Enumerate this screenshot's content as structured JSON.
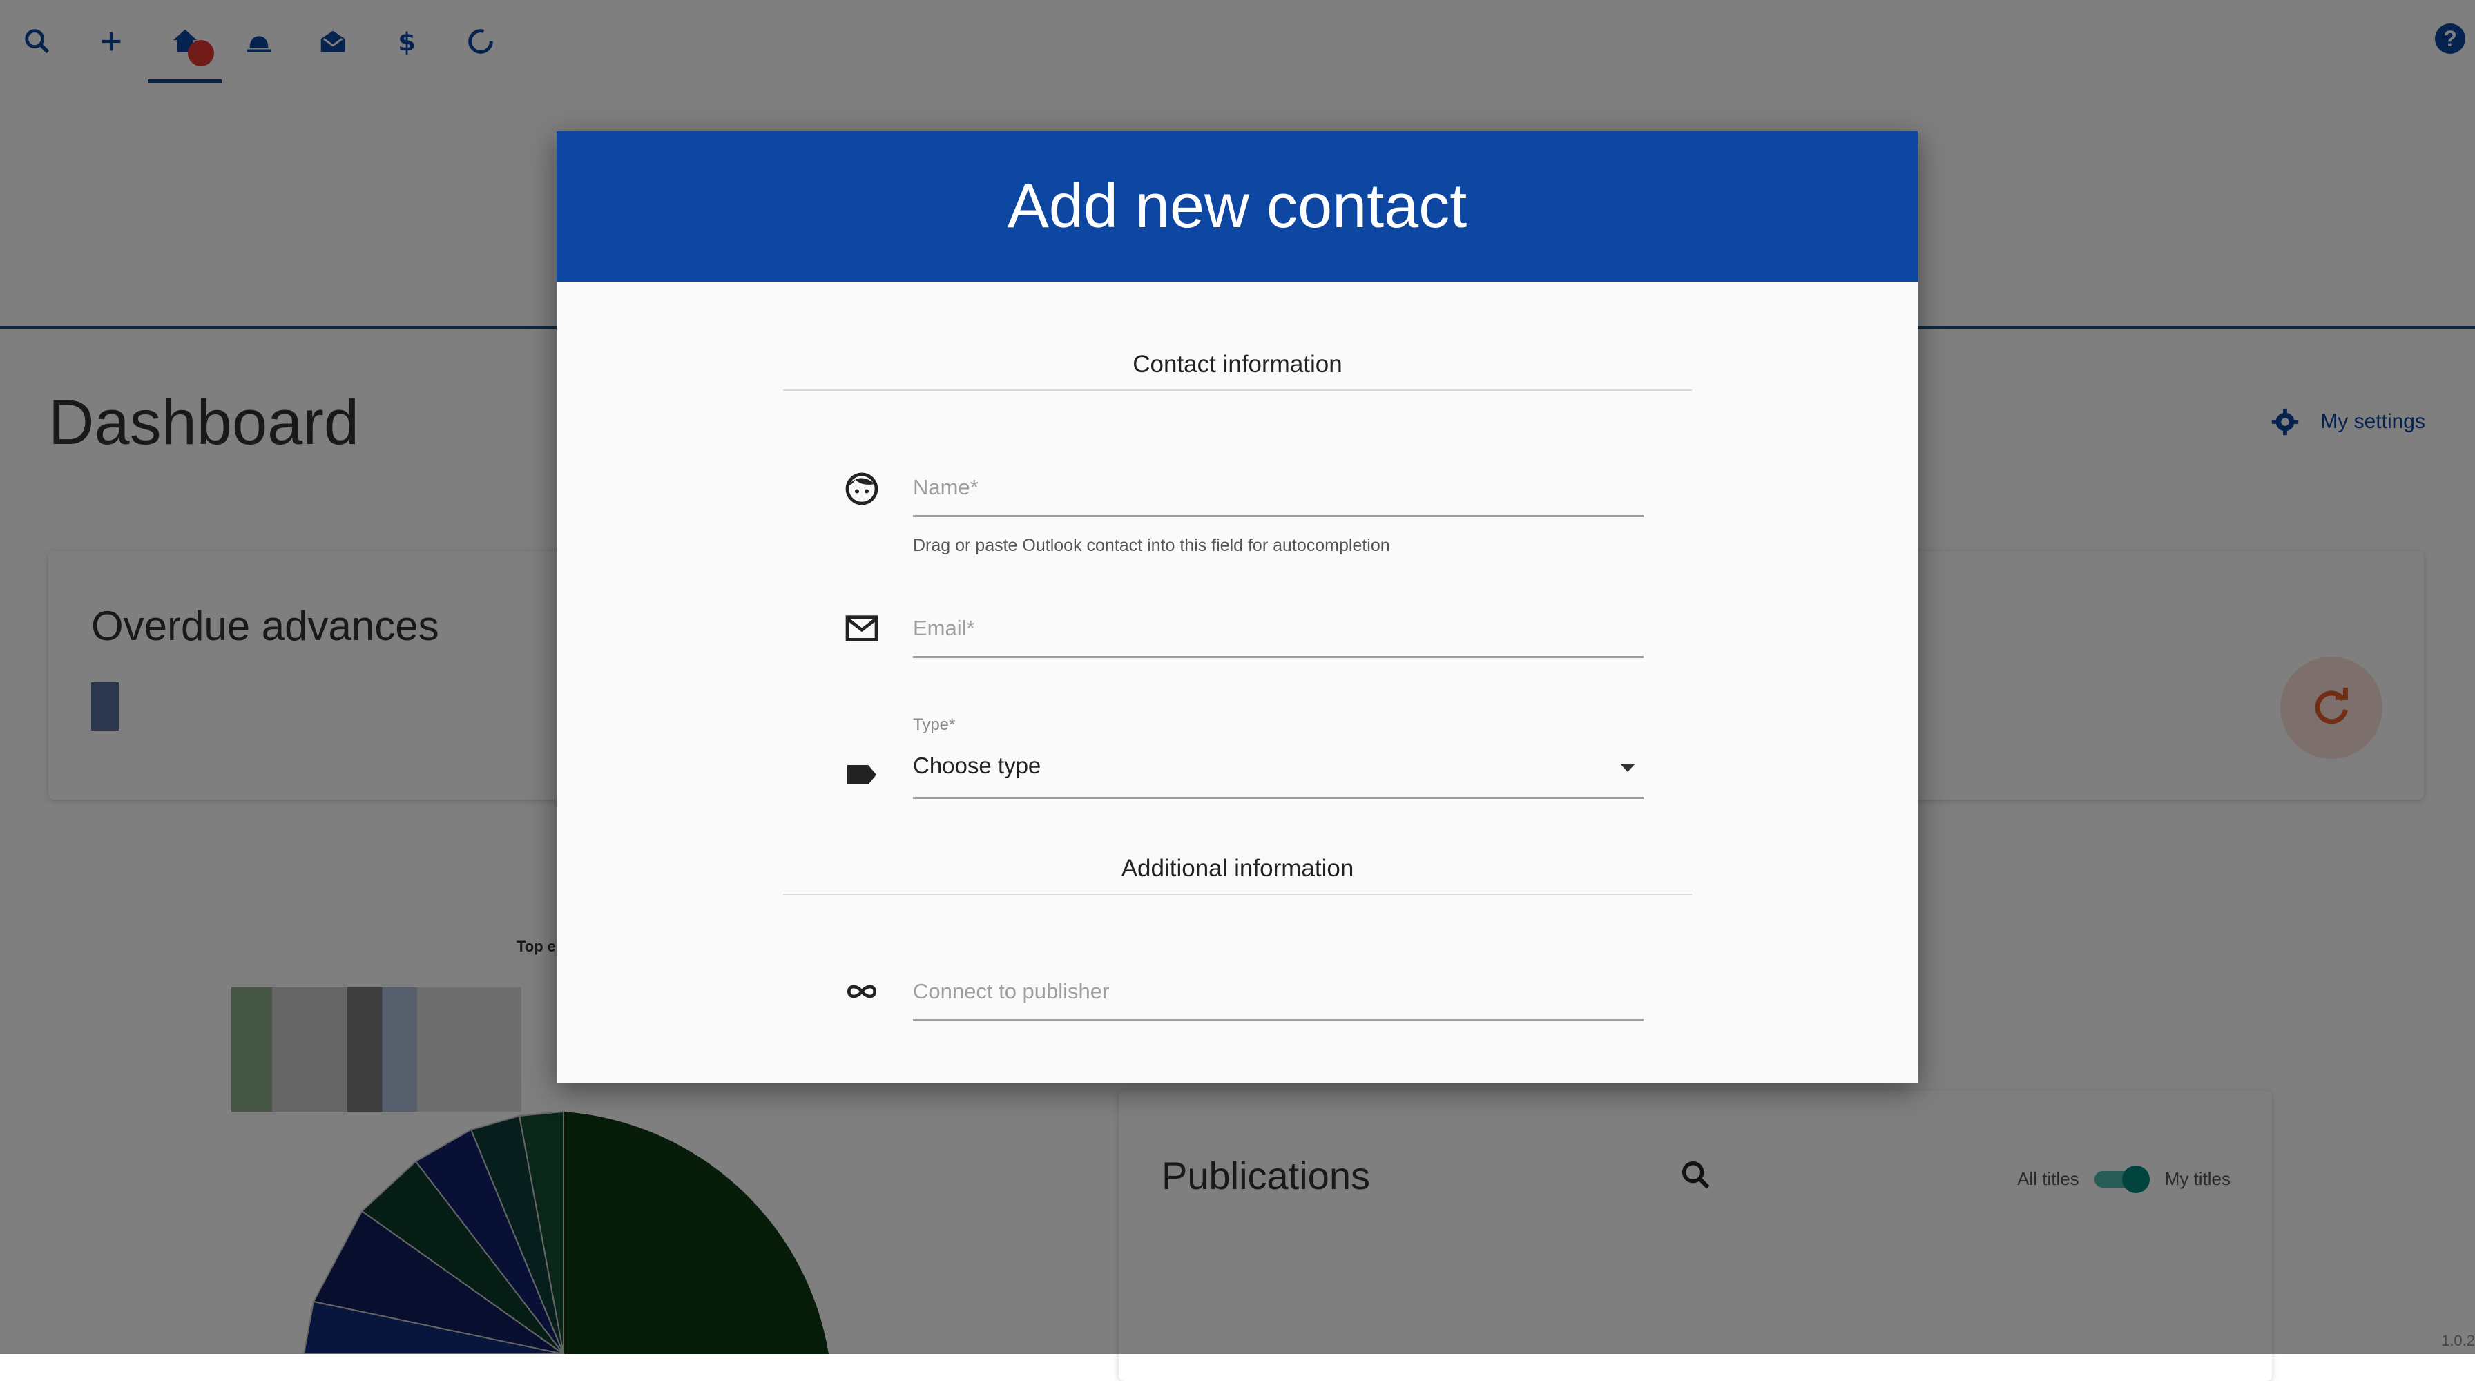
{
  "app": {
    "nav_icons": [
      "search-icon",
      "add-icon",
      "home-icon",
      "sales-icon",
      "mail-icon",
      "dollar-icon",
      "progress-icon"
    ],
    "help_label": "?",
    "accent_color": "#0d47a1",
    "version": "1.0.2"
  },
  "dashboard": {
    "title": "Dashboard",
    "settings_label": "My settings",
    "overdue_title": "Overdue advances",
    "chart_caption": "Top e",
    "publications": {
      "title": "Publications",
      "toggle_left": "All titles",
      "toggle_right": "My titles"
    }
  },
  "dialog": {
    "title": "Add new contact",
    "section_contact": "Contact information",
    "name": {
      "placeholder": "Name*",
      "hint": "Drag or paste Outlook contact into this field for autocompletion",
      "icon": "face-icon"
    },
    "email": {
      "placeholder": "Email*",
      "icon": "mail-outline-icon"
    },
    "type": {
      "label": "Type*",
      "value": "Choose type",
      "icon": "label-icon"
    },
    "section_additional": "Additional information",
    "publisher": {
      "placeholder": "Connect to publisher",
      "icon": "link-icon"
    }
  }
}
